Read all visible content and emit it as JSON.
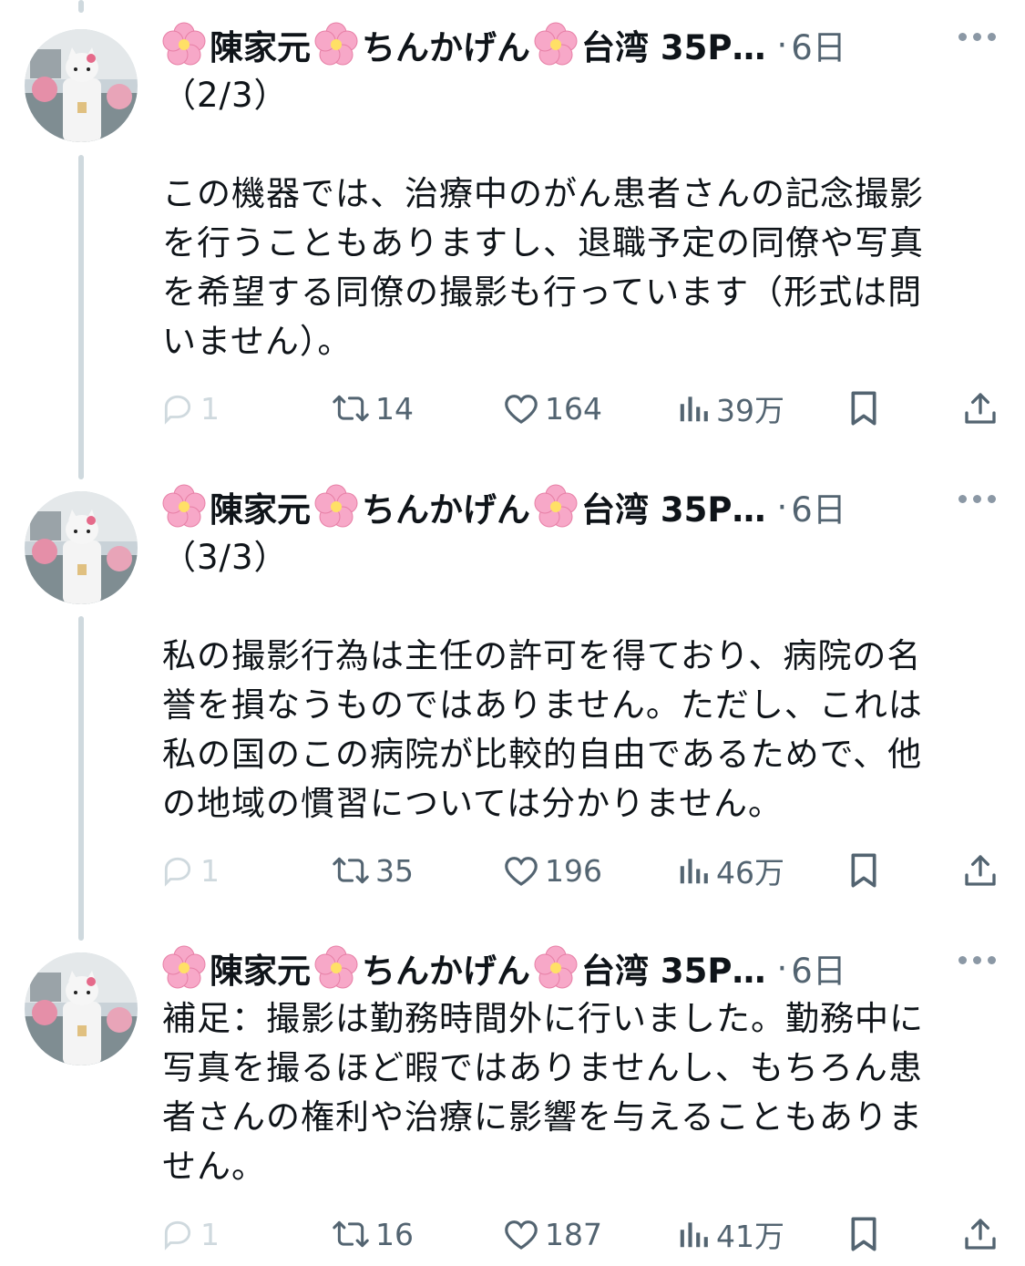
{
  "author": {
    "name_parts": [
      "陳家元",
      "ちんかげん",
      "台湾 35P…"
    ],
    "flower_emoji": "cherry-blossom"
  },
  "separator": "·",
  "colors": {
    "text": "#0f1419",
    "secondary": "#536471",
    "thread_line": "#cfd9de",
    "blossom": "#f7a8c8"
  },
  "tweets": [
    {
      "time": "6日",
      "body": "（2/3）\n\nこの機器では、治療中のがん患者さんの記念撮影\nを行うこともありますし、退職予定の同僚や写真\nを希望する同僚の撮影も行っています（形式は問\nいません）。",
      "replies": "1",
      "retweets": "14",
      "likes": "164",
      "views": "39万"
    },
    {
      "time": "6日",
      "body": "（3/3）\n\n私の撮影行為は主任の許可を得ており、病院の名\n誉を損なうものではありません。ただし、これは\n私の国のこの病院が比較的自由であるためで、他\nの地域の慣習については分かりません。",
      "replies": "1",
      "retweets": "35",
      "likes": "196",
      "views": "46万"
    },
    {
      "time": "6日",
      "body": "補足：撮影は勤務時間外に行いました。勤務中に\n写真を撮るほど暇ではありませんし、もちろん患\n者さんの権利や治療に影響を与えることもありま\nせん。",
      "replies": "1",
      "retweets": "16",
      "likes": "187",
      "views": "41万"
    }
  ]
}
